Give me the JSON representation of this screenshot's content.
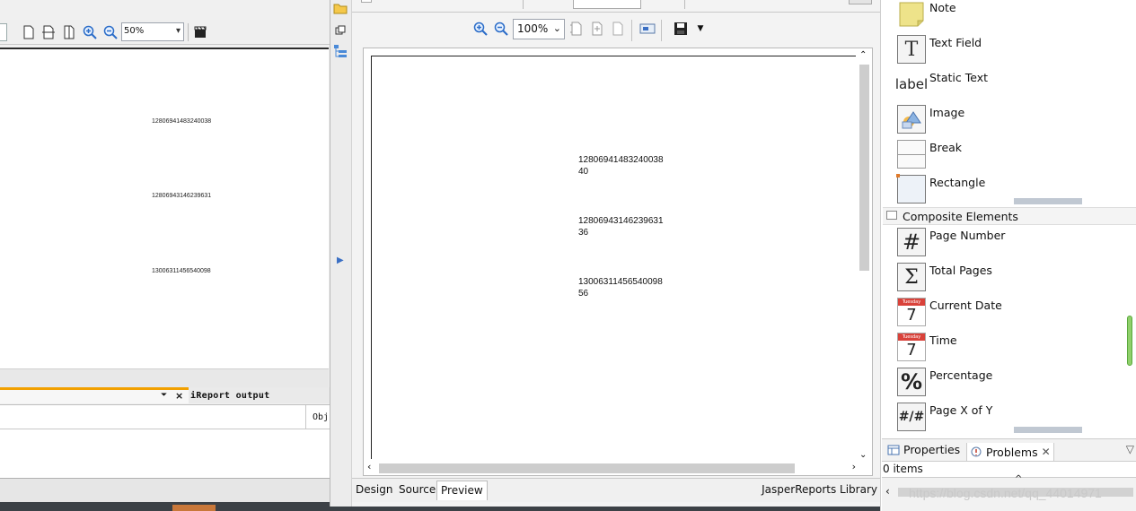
{
  "left": {
    "zoom_value": "50%",
    "report_numbers": [
      "12806941483240038",
      "12806943146239631",
      "13006311456540098"
    ],
    "output_tab_label": "iReport output",
    "obj_label": "Obj"
  },
  "preview": {
    "zoom_value": "100%",
    "rows": [
      {
        "id": "12806941483240038",
        "value": "40"
      },
      {
        "id": "12806943146239631",
        "value": "36"
      },
      {
        "id": "13006311456540098",
        "value": "56"
      }
    ],
    "tabs": [
      "Design",
      "Source",
      "Preview"
    ],
    "active_tab": "Preview",
    "library_label": "JasperReports Library"
  },
  "palette": {
    "basic_items": [
      {
        "label": "Note",
        "icon": "note-icon"
      },
      {
        "label": "Text Field",
        "icon": "text-field-icon"
      },
      {
        "label": "Static Text",
        "icon": "static-text-icon"
      },
      {
        "label": "Image",
        "icon": "image-icon"
      },
      {
        "label": "Break",
        "icon": "break-icon"
      },
      {
        "label": "Rectangle",
        "icon": "rectangle-icon"
      }
    ],
    "composite_header": "Composite Elements",
    "composite_items": [
      {
        "label": "Page Number",
        "icon": "page-number-icon"
      },
      {
        "label": "Total Pages",
        "icon": "total-pages-icon"
      },
      {
        "label": "Current Date",
        "icon": "calendar-icon"
      },
      {
        "label": "Time",
        "icon": "calendar-icon"
      },
      {
        "label": "Percentage",
        "icon": "percentage-icon"
      },
      {
        "label": "Page X of Y",
        "icon": "page-x-of-y-icon"
      }
    ],
    "static_text_glyph": "label",
    "text_field_glyph": "T",
    "page_number_glyph": "#",
    "total_pages_glyph": "Σ",
    "calendar_day": "7",
    "calendar_month": "Tuesday",
    "percentage_glyph": "%",
    "page_x_of_y_glyph": "#/#"
  },
  "bottom_panel": {
    "tabs": [
      "Properties",
      "Problems"
    ],
    "items_count": "0 items"
  },
  "watermark": "https://blog.csdn.net/qq_44014971",
  "colors": {
    "accent_orange": "#f2a000",
    "scroll_green": "#8fd06b",
    "calendar_red": "#d9423a"
  }
}
